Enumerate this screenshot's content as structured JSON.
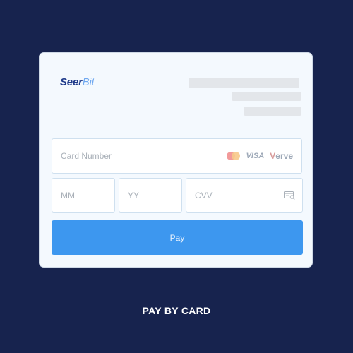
{
  "brand": {
    "logo_part1": "Seer",
    "logo_part2": "Bit"
  },
  "form": {
    "card_number_placeholder": "Card Number",
    "month_placeholder": "MM",
    "year_placeholder": "YY",
    "cvv_placeholder": "CVV",
    "pay_label": "Pay"
  },
  "card_brands": {
    "visa": "VISA",
    "verve_first": "V",
    "verve_rest": "erve",
    "mastercard_icon": "mastercard-icon"
  },
  "caption": "PAY BY CARD",
  "colors": {
    "background": "#17234e",
    "card": "#f4f9fe",
    "accent": "#3d97ef",
    "logo_dark": "#1e3a8a",
    "logo_light": "#6fa8f0"
  }
}
